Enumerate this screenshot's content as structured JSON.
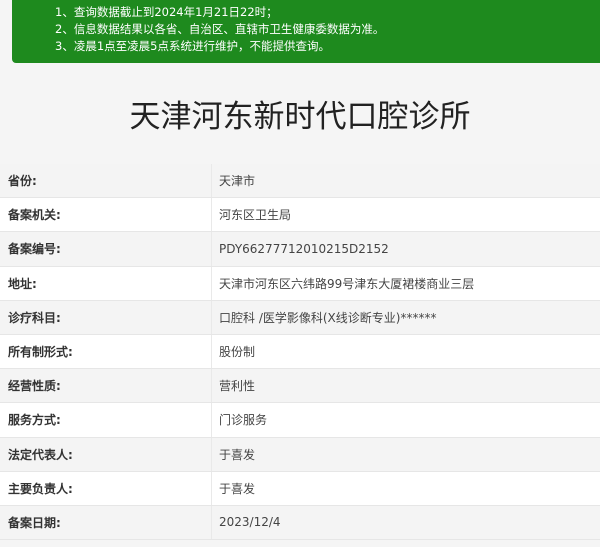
{
  "notice": {
    "lines": [
      "1、查询数据截止到2024年1月21日22时；",
      "2、信息数据结果以各省、自治区、直辖市卫生健康委数据为准。",
      "3、凌晨1点至凌晨5点系统进行维护，不能提供查询。"
    ]
  },
  "page": {
    "title": "天津河东新时代口腔诊所"
  },
  "details": {
    "rows": [
      {
        "label": "省份:",
        "value": "天津市"
      },
      {
        "label": "备案机关:",
        "value": "河东区卫生局"
      },
      {
        "label": "备案编号:",
        "value": "PDY66277712010215D2152"
      },
      {
        "label": "地址:",
        "value": "天津市河东区六纬路99号津东大厦裙楼商业三层"
      },
      {
        "label": "诊疗科目:",
        "value": "口腔科 /医学影像科(X线诊断专业)******"
      },
      {
        "label": "所有制形式:",
        "value": "股份制"
      },
      {
        "label": "经营性质:",
        "value": "营利性"
      },
      {
        "label": "服务方式:",
        "value": "门诊服务"
      },
      {
        "label": "法定代表人:",
        "value": "于喜发"
      },
      {
        "label": "主要负责人:",
        "value": "于喜发"
      },
      {
        "label": "备案日期:",
        "value": "2023/12/4"
      }
    ]
  },
  "colors": {
    "notice_bg": "#1e8a1e",
    "page_bg": "#f5f5f5"
  }
}
